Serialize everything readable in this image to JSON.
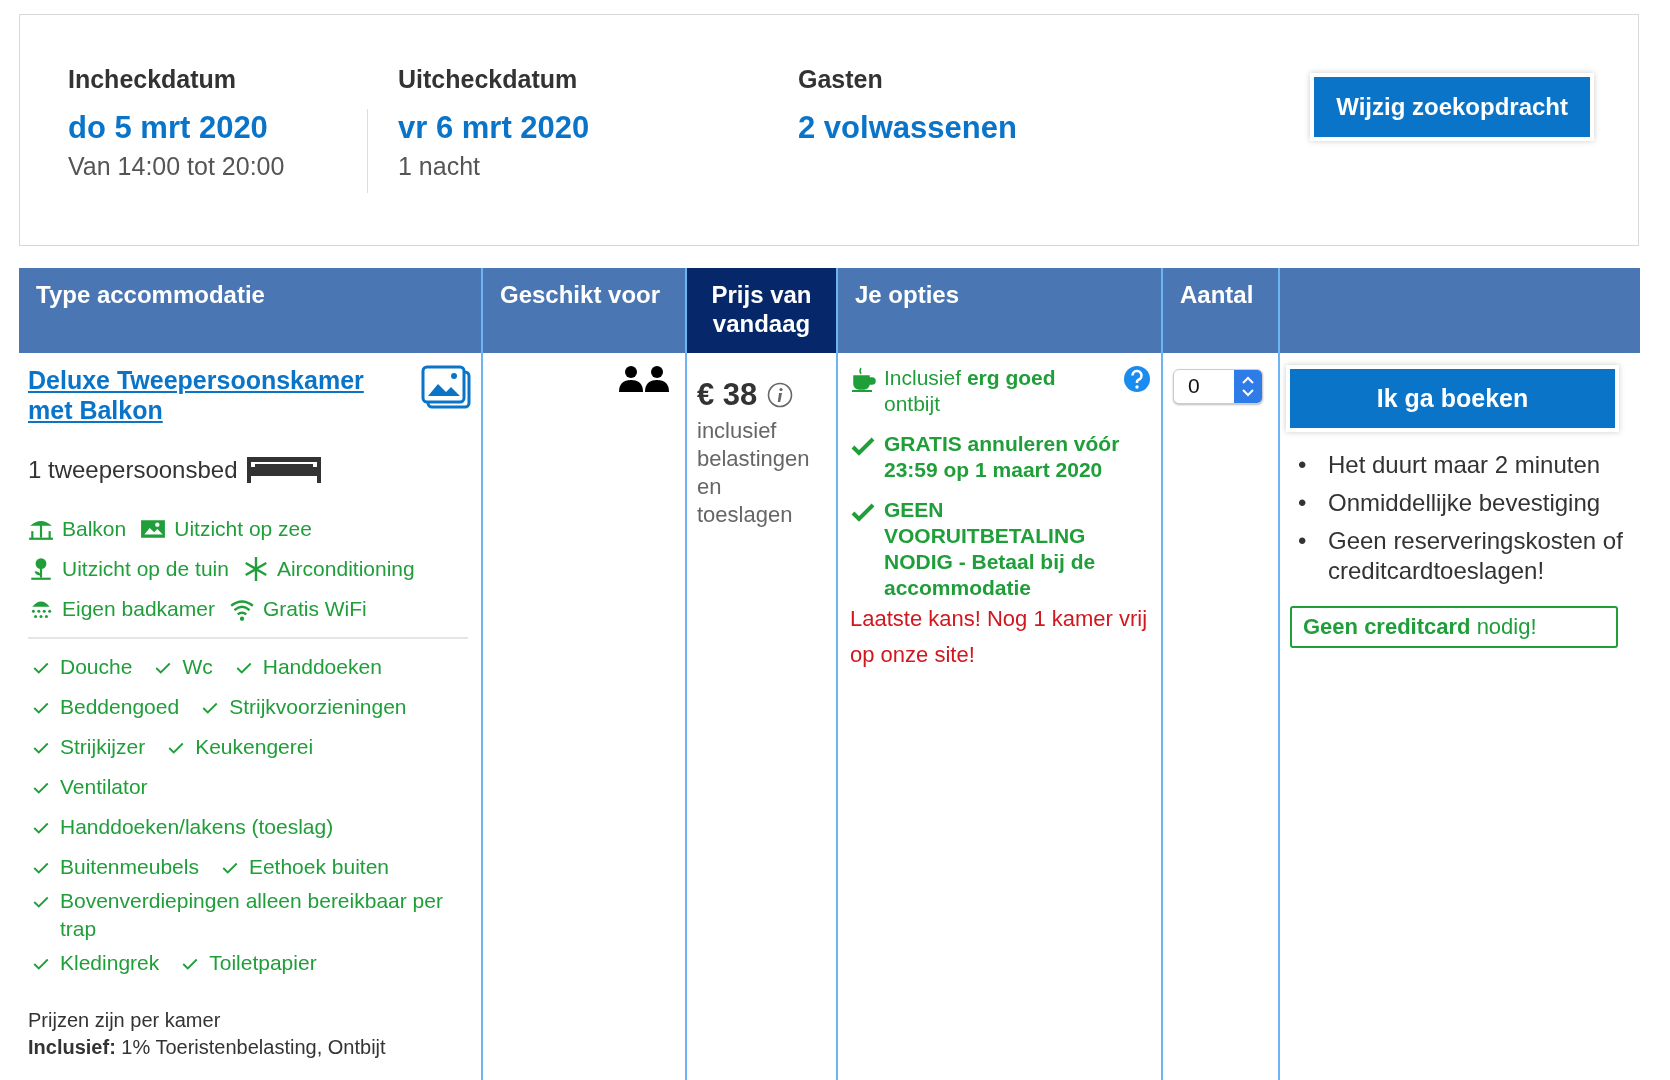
{
  "search_summary": {
    "checkin": {
      "label": "Incheckdatum",
      "date": "do 5 mrt 2020",
      "note": "Van 14:00 tot 20:00"
    },
    "checkout": {
      "label": "Uitcheckdatum",
      "date": "vr 6 mrt 2020",
      "note": "1 nacht"
    },
    "guests": {
      "label": "Gasten",
      "value": "2 volwassenen"
    },
    "button": "Wijzig zoekopdracht"
  },
  "table": {
    "columns": [
      {
        "label": "Type accommodatie",
        "selected": false
      },
      {
        "label": "Geschikt voor",
        "selected": false
      },
      {
        "label": "Prijs van vandaag",
        "selected": true
      },
      {
        "label": "Je opties",
        "selected": false
      },
      {
        "label": "Aantal",
        "selected": false
      },
      {
        "selected": false
      }
    ],
    "room": {
      "name": "Deluxe Tweepersoonskamer met Balkon",
      "bed": "1 tweepersoonsbed",
      "facilities": [
        {
          "kind": "balcony",
          "label": "Balkon"
        },
        {
          "kind": "view",
          "label": "Uitzicht op zee"
        },
        {
          "kind": "garden",
          "label": "Uitzicht op de tuin"
        },
        {
          "kind": "aircon",
          "label": "Airconditioning"
        },
        {
          "kind": "bathroom",
          "label": "Eigen badkamer"
        },
        {
          "kind": "wifi",
          "label": "Gratis WiFi"
        }
      ],
      "amenity_rows": [
        [
          "Douche",
          "Wc",
          "Handdoeken"
        ],
        [
          "Beddengoed",
          "Strijkvoorzieningen"
        ],
        [
          "Strijkijzer",
          "Keukengerei"
        ],
        [
          "Ventilator"
        ],
        [
          "Handdoeken/lakens (toeslag)"
        ],
        [
          "Buitenmeubels",
          "Eethoek buiten"
        ],
        [
          "Bovenverdiepingen alleen bereikbaar per trap"
        ],
        [
          "Kledingrek",
          "Toiletpapier"
        ]
      ],
      "price_note": "Prijzen zijn per kamer",
      "included": "**Inclusief:** 1% Toeristenbelasting, Ontbijt"
    },
    "price": {
      "amount": "€ 38",
      "note": "inclusief belastingen en toeslagen"
    },
    "options": [
      {
        "kind": "breakfast",
        "text": "Inclusief **erg goed** ontbijt"
      },
      {
        "kind": "check",
        "text": "GRATIS annuleren vóór 23:59 op 1 maart 2020"
      },
      {
        "kind": "check",
        "text": "GEEN VOORUITBETALING NODIG - Betaal bij de accommodatie"
      },
      {
        "kind": "warning",
        "text": "Laatste kans! Nog 1 kamer vrij op onze site!"
      }
    ],
    "quantity": "0",
    "book_button": "Ik ga boeken",
    "benefits": [
      {
        "marker": "•",
        "text": "Het duurt maar 2 minuten"
      },
      {
        "marker": "•",
        "text": "Onmiddellijke bevestiging"
      },
      {
        "marker": "•",
        "text": "Geen reserveringskosten of creditcardtoeslagen!"
      }
    ],
    "no_card": "**Geen creditcard** nodig!"
  }
}
